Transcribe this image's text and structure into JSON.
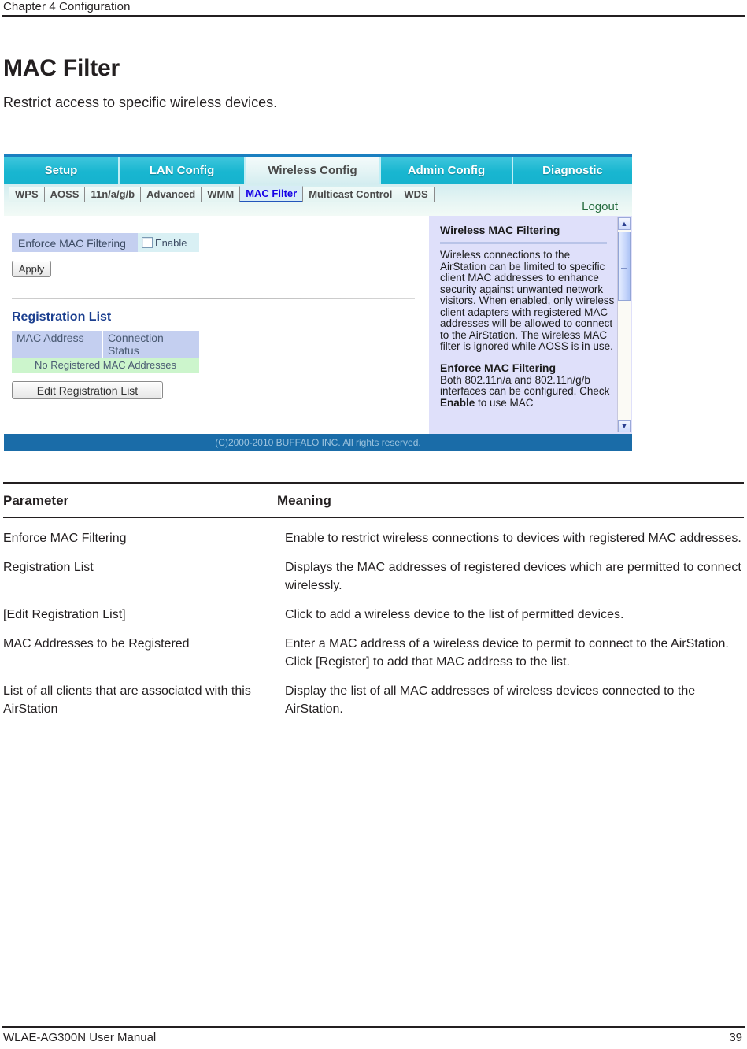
{
  "page": {
    "chapter": "Chapter 4  Configuration",
    "title": "MAC Filter",
    "subtitle": "Restrict access to specific wireless devices.",
    "footer_left": "WLAE-AG300N User Manual",
    "footer_page": "39"
  },
  "screenshot": {
    "main_tabs": [
      {
        "label": "Setup",
        "active": false
      },
      {
        "label": "LAN Config",
        "active": false
      },
      {
        "label": "Wireless Config",
        "active": true
      },
      {
        "label": "Admin Config",
        "active": false
      },
      {
        "label": "Diagnostic",
        "active": false
      }
    ],
    "sub_tabs": [
      {
        "label": "WPS",
        "active": false
      },
      {
        "label": "AOSS",
        "active": false
      },
      {
        "label": "11n/a/g/b",
        "active": false
      },
      {
        "label": "Advanced",
        "active": false
      },
      {
        "label": "WMM",
        "active": false
      },
      {
        "label": "MAC Filter",
        "active": true
      },
      {
        "label": "Multicast Control",
        "active": false
      },
      {
        "label": "WDS",
        "active": false
      }
    ],
    "logout_label": "Logout",
    "config": {
      "enforce_label": "Enforce MAC Filtering",
      "enable_label": "Enable",
      "enable_checked": false,
      "apply_label": "Apply",
      "registration_title": "Registration List",
      "table_headers": [
        "MAC Address",
        "Connection Status"
      ],
      "empty_message": "No Registered MAC Addresses",
      "edit_button_label": "Edit Registration List"
    },
    "help": {
      "heading1": "Wireless MAC Filtering",
      "body1": "Wireless connections to the AirStation can be limited to specific client MAC addresses to enhance security against unwanted network visitors. When enabled, only wireless client adapters with registered MAC addresses will be allowed to connect to the AirStation. The wireless MAC filter is ignored while AOSS is in use.",
      "heading2": "Enforce MAC Filtering",
      "body2_a": "Both 802.11n/a and 802.11n/g/b interfaces can be configured. Check ",
      "body2_bold": "Enable",
      "body2_b": " to use MAC"
    },
    "copyright": "(C)2000-2010 BUFFALO INC. All rights reserved.",
    "colors": {
      "tab_active_text": "#4a4a4a",
      "tab_cyan": "#18b6d0",
      "subtab_active_text": "#1500e6",
      "logout_green": "#246b3e",
      "heading_blue": "#1b3f8f",
      "label_blue": "#c4cff0",
      "empty_green": "#ccf5cc",
      "help_bg": "#dfe0fa",
      "footer_blue": "#1a6ca8"
    }
  },
  "param_table": {
    "headers": [
      "Parameter",
      "Meaning"
    ],
    "rows": [
      {
        "parameter": "Enforce MAC Filtering",
        "meaning": "Enable to restrict wireless connections to devices with registered MAC addresses."
      },
      {
        "parameter": "Registration List",
        "meaning": "Displays the MAC addresses of registered devices which are permitted to connect wirelessly."
      },
      {
        "parameter": "[Edit Registration List]",
        "meaning": "Click to add a wireless device to the list of permitted devices."
      },
      {
        "parameter": "MAC Addresses to be Registered",
        "meaning": "Enter a MAC address of a wireless device to permit to connect to the AirStation. Click [Register] to add that MAC address to the list."
      },
      {
        "parameter": "List of all clients that are associated with this AirStation",
        "meaning": "Display the list of all MAC addresses of wireless devices connected to the AirStation."
      }
    ]
  }
}
